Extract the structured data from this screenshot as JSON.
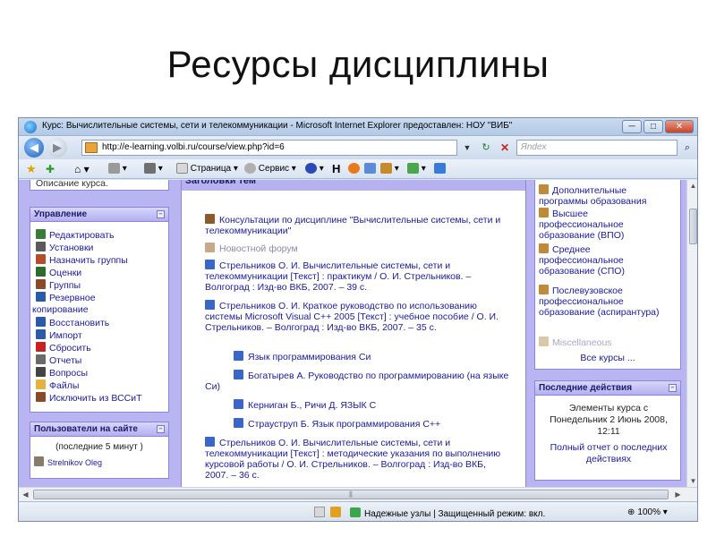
{
  "slide": {
    "title": "Ресурсы дисциплины"
  },
  "window": {
    "title": "Курс: Вычислительные системы, сети и телекоммуникации - Microsoft Internet Explorer предоставлен: НОУ \"ВИБ\"",
    "controls": {
      "minimize": "─",
      "maximize": "□",
      "close": "✕"
    }
  },
  "address": {
    "url": "http://e-learning.volbi.ru/course/view.php?id=6",
    "search_placeholder": "Яndex"
  },
  "toolbar": {
    "page_label": "Страница",
    "service_label": "Сервис"
  },
  "left": {
    "description_stub": "Описание курса.",
    "management": {
      "title": "Управление",
      "items": [
        {
          "label": "Редактировать",
          "color": "#3a7a3a"
        },
        {
          "label": "Установки",
          "color": "#5a5a5a"
        },
        {
          "label": "Назначить группы",
          "color": "#b44d2a"
        },
        {
          "label": "Оценки",
          "color": "#2d6c2d"
        },
        {
          "label": "Группы",
          "color": "#8a4a2a"
        },
        {
          "label": "Резервное",
          "color": "#2a5aa8"
        },
        {
          "label": "копирование",
          "color": ""
        },
        {
          "label": "Восстановить",
          "color": "#2a5aa8"
        },
        {
          "label": "Импорт",
          "color": "#2a5aa8"
        },
        {
          "label": "Сбросить",
          "color": "#c7221f"
        },
        {
          "label": "Отчеты",
          "color": "#6a6a6a"
        },
        {
          "label": "Вопросы",
          "color": "#444"
        },
        {
          "label": "Файлы",
          "color": "#e3b33c"
        },
        {
          "label": "Исключить из ВССиТ",
          "color": "#8a4a2a"
        }
      ]
    },
    "users": {
      "title": "Пользователи на сайте",
      "period": "(последние 5 минут )",
      "user": "Strelnikov Oleg"
    }
  },
  "center": {
    "section_head": "Заголовки тем",
    "resources": [
      {
        "text": "Консультации по дисциплине \"Вычислительные системы, сети и телекоммуникации\"",
        "icon": "people-icon"
      },
      {
        "text": "Новостной форум",
        "icon": "people-icon"
      },
      {
        "text": "Стрельников О. И. Вычислительные системы, сети и телекоммуникации [Текст] : практикум / О. И. Стрельников. – Волгоград : Изд-во ВКБ, 2007. – 39 с.",
        "icon": "document-icon"
      },
      {
        "text": "Стрельников О. И. Краткое руководство по использованию системы Microsoft Visual C++ 2005 [Текст] : учебное пособие / О. И. Стрельников. – Волгоград : Изд-во ВКБ, 2007. – 35 с.",
        "icon": "document-icon"
      },
      {
        "text": "Язык программирования Си",
        "icon": "document-icon"
      },
      {
        "text": "Богатырев А. Руководство по программированию (на языке Си)",
        "icon": "document-icon"
      },
      {
        "text": "Керниган Б., Ричи Д. ЯЗЫК С",
        "icon": "document-icon"
      },
      {
        "text": "Страуструп Б. Язык программирования С++",
        "icon": "document-icon"
      },
      {
        "text": "Стрельников О. И. Вычислительные системы, сети и телекоммуникации [Текст] : методические указания по выполнению курсовой работы / О. И. Стрельников. – Волгоград : Изд-во ВКБ, 2007. – 36 с.",
        "icon": "document-icon"
      }
    ]
  },
  "right": {
    "categories": [
      "Дополнительные программы образования",
      "Высшее профессиональное образование (ВПО)",
      "Среднее профессиональное образование (СПО)",
      "Послевузовское профессиональное образование (аспирантура)",
      "Miscellaneous"
    ],
    "all_courses": "Все курсы ...",
    "recent": {
      "title": "Последние действия",
      "text": "Элементы курса с Понедельник 2 Июнь 2008, 12:11",
      "link": "Полный отчет о последних действиях"
    }
  },
  "status": {
    "text": "Надежные узлы | Защищенный режим: вкл.",
    "zoom": "100%"
  }
}
